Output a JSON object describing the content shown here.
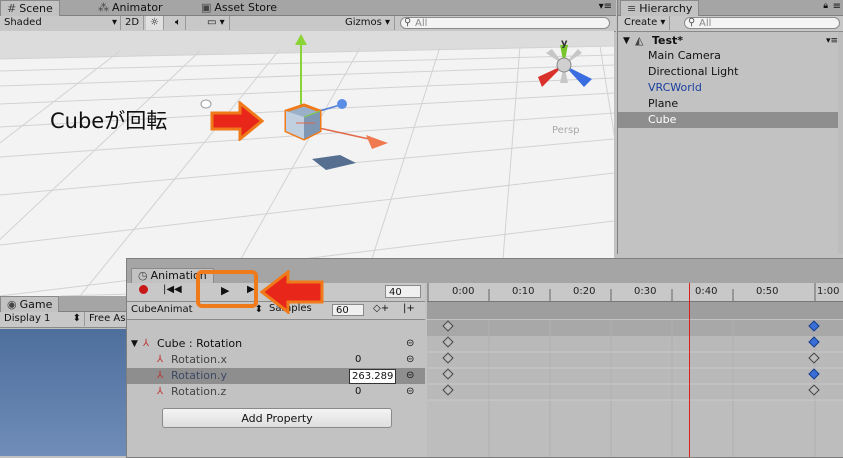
{
  "scene_panel": {
    "tabs": [
      {
        "label": "Scene",
        "icon": "grid-icon"
      },
      {
        "label": "Animator",
        "icon": "animator-icon"
      },
      {
        "label": "Asset Store",
        "icon": "store-icon"
      }
    ],
    "toolbar": {
      "shading_mode": "Shaded",
      "mode_2d": "2D",
      "gizmos_label": "Gizmos",
      "search_placeholder": "All"
    },
    "gizmo_axis_label": "y",
    "persp_label": "Persp",
    "annotation_text": "Cubeが回転"
  },
  "hierarchy_panel": {
    "tab_label": "Hierarchy",
    "create_label": "Create",
    "search_placeholder": "All",
    "scene_name": "Test*",
    "items": [
      {
        "label": "Main Camera",
        "color": "#111111",
        "selected": false
      },
      {
        "label": "Directional Light",
        "color": "#111111",
        "selected": false
      },
      {
        "label": "VRCWorld",
        "color": "#1a3fa0",
        "selected": false
      },
      {
        "label": "Plane",
        "color": "#111111",
        "selected": false
      },
      {
        "label": "Cube",
        "color": "#ffffff",
        "selected": true
      }
    ]
  },
  "game_panel": {
    "tab_label": "Game",
    "display_label": "Display 1",
    "aspect_label": "Free As"
  },
  "animation_panel": {
    "tab_label": "Animation",
    "frame_value": "40",
    "clip_name": "CubeAnimat",
    "samples_label": "Samples",
    "samples_value": "60",
    "timeline_ticks": [
      "0:00",
      "0:10",
      "0:20",
      "0:30",
      "0:40",
      "0:50",
      "1:00"
    ],
    "object_property": "Cube : Rotation",
    "properties": [
      {
        "label": "Rotation.x",
        "value": "0"
      },
      {
        "label": "Rotation.y",
        "value": "263.289"
      },
      {
        "label": "Rotation.z",
        "value": "0"
      }
    ],
    "add_property_label": "Add Property"
  },
  "colors": {
    "highlight_orange": "#f07a1a",
    "arrow_red": "#e8261a",
    "playhead_red": "#d92020",
    "keyframe_blue": "#3a6fd8"
  }
}
